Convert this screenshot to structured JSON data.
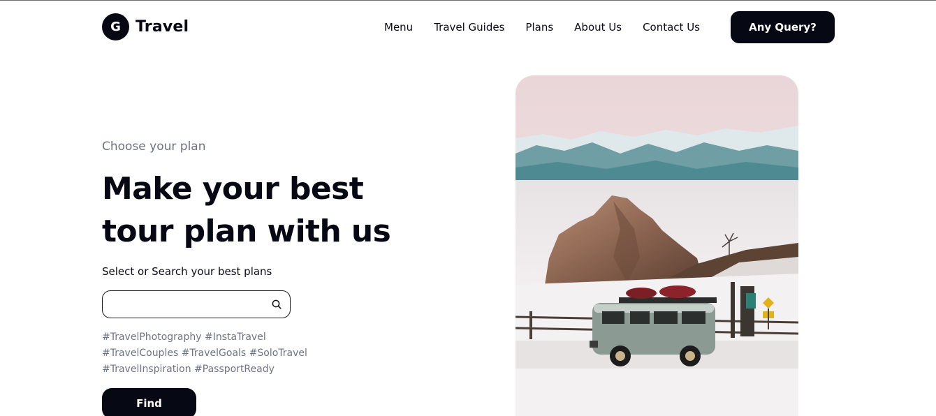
{
  "header": {
    "logo_letter": "G",
    "logo_text": "Travel",
    "nav": [
      "Menu",
      "Travel Guides",
      "Plans",
      "About Us",
      "Contact Us"
    ],
    "cta_label": "Any Query?"
  },
  "hero": {
    "eyebrow": "Choose your plan",
    "headline_line1": "Make your best",
    "headline_line2": "tour plan with us",
    "subhead": "Select or Search your best plans",
    "search_value": "",
    "search_placeholder": "",
    "tags": [
      "#TravelPhotography #InstaTravel",
      "#TravelCouples #TravelGoals #SoloTravel",
      "#TravelInspiration #PassportReady"
    ],
    "find_label": "Find"
  },
  "colors": {
    "primary": "#060814",
    "muted_text": "#6b7382",
    "background": "#ffffff"
  },
  "icons": {
    "search": "search-icon"
  }
}
